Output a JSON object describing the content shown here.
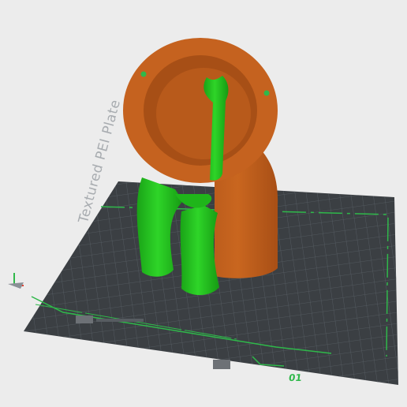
{
  "viewport": {
    "background_color": "#ececec",
    "bed": {
      "label": "Textured PEI Plate",
      "plate_number": "01",
      "bed_color": "#3b3f43",
      "grid_color": "#5b6065",
      "accent_color": "#2fb84a"
    },
    "model": {
      "object_color": "#c5621f",
      "support_color": "#22c51d"
    }
  }
}
